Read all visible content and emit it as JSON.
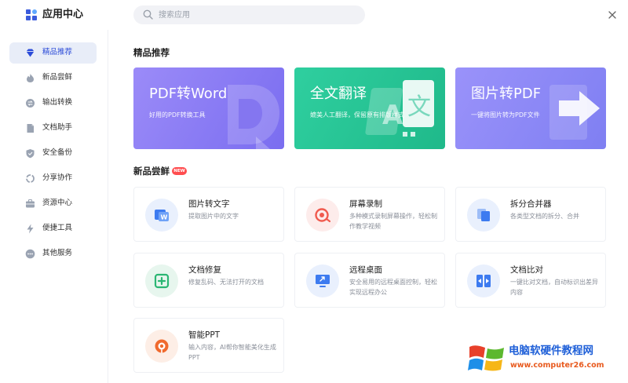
{
  "header": {
    "title": "应用中心",
    "search_placeholder": "搜索应用"
  },
  "sidebar": {
    "items": [
      {
        "label": "精品推荐",
        "icon": "diamond-icon",
        "active": true
      },
      {
        "label": "新品尝鲜",
        "icon": "flame-icon"
      },
      {
        "label": "输出转换",
        "icon": "convert-icon"
      },
      {
        "label": "文档助手",
        "icon": "document-icon"
      },
      {
        "label": "安全备份",
        "icon": "shield-icon"
      },
      {
        "label": "分享协作",
        "icon": "share-icon"
      },
      {
        "label": "资源中心",
        "icon": "briefcase-icon"
      },
      {
        "label": "便捷工具",
        "icon": "lightning-icon"
      },
      {
        "label": "其他服务",
        "icon": "more-icon"
      }
    ]
  },
  "sections": {
    "featured_title": "精品推荐",
    "new_title": "新品尝鲜",
    "new_badge": "NEW"
  },
  "banners": [
    {
      "title": "PDF转Word",
      "subtitle": "好用的PDF转换工具",
      "color": "#8b7cf6"
    },
    {
      "title": "全文翻译",
      "subtitle": "媲美人工翻译，保留原有排版样式",
      "color": "#27c39a"
    },
    {
      "title": "图片转PDF",
      "subtitle": "一键将图片转为PDF文件",
      "color": "#8c8cf7"
    }
  ],
  "cards": [
    {
      "title": "图片转文字",
      "desc": "提取图片中的文字",
      "icon": "image-text-icon",
      "color": "#3d7bf0"
    },
    {
      "title": "屏幕录制",
      "desc": "多种模式录制屏幕操作，轻松制作教学视频",
      "icon": "record-icon",
      "color": "#f05a4e"
    },
    {
      "title": "拆分合并器",
      "desc": "各类型文档的拆分、合并",
      "icon": "split-merge-icon",
      "color": "#3d7bf0"
    },
    {
      "title": "文档修复",
      "desc": "修复乱码、无法打开的文档",
      "icon": "repair-icon",
      "color": "#2bb673"
    },
    {
      "title": "远程桌面",
      "desc": "安全易用的远程桌面控制，轻松实现远程办公",
      "icon": "remote-desktop-icon",
      "color": "#3d7bf0"
    },
    {
      "title": "文档比对",
      "desc": "一键比对文档，自动标识出差异内容",
      "icon": "compare-icon",
      "color": "#3d7bf0"
    },
    {
      "title": "智能PPT",
      "desc": "输入内容，AI帮你智能美化生成PPT",
      "icon": "ppt-icon",
      "color": "#f06a2e"
    }
  ],
  "watermark": {
    "text": "电脑软硬件教程网",
    "url": "www.computer26.com"
  }
}
